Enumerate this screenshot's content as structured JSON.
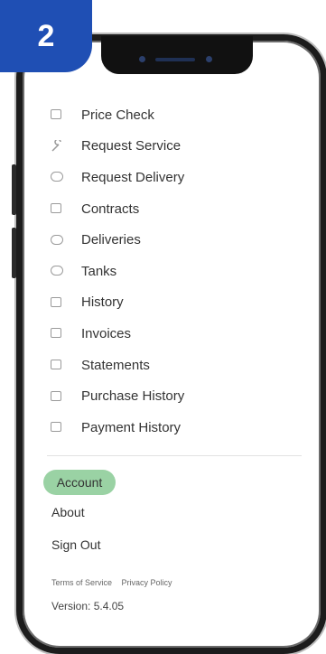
{
  "step_badge": "2",
  "menu": [
    {
      "label": "Price Check",
      "icon": "price-check-icon"
    },
    {
      "label": "Request Service",
      "icon": "wrench-icon"
    },
    {
      "label": "Request Delivery",
      "icon": "truck-icon"
    },
    {
      "label": "Contracts",
      "icon": "contract-icon"
    },
    {
      "label": "Deliveries",
      "icon": "delivery-truck-icon"
    },
    {
      "label": "Tanks",
      "icon": "tank-icon"
    },
    {
      "label": "History",
      "icon": "history-icon"
    },
    {
      "label": "Invoices",
      "icon": "invoice-icon"
    },
    {
      "label": "Statements",
      "icon": "statement-icon"
    },
    {
      "label": "Purchase History",
      "icon": "purchase-history-icon"
    },
    {
      "label": "Payment History",
      "icon": "payment-icon"
    }
  ],
  "account": {
    "label": "Account",
    "highlight_color": "#9ad2a4"
  },
  "about": "About",
  "sign_out": "Sign Out",
  "legal": {
    "terms": "Terms of Service",
    "privacy": "Privacy Policy"
  },
  "version": "Version: 5.4.05",
  "colors": {
    "badge": "#1f4fb4",
    "frame": "#1c1c1c"
  }
}
